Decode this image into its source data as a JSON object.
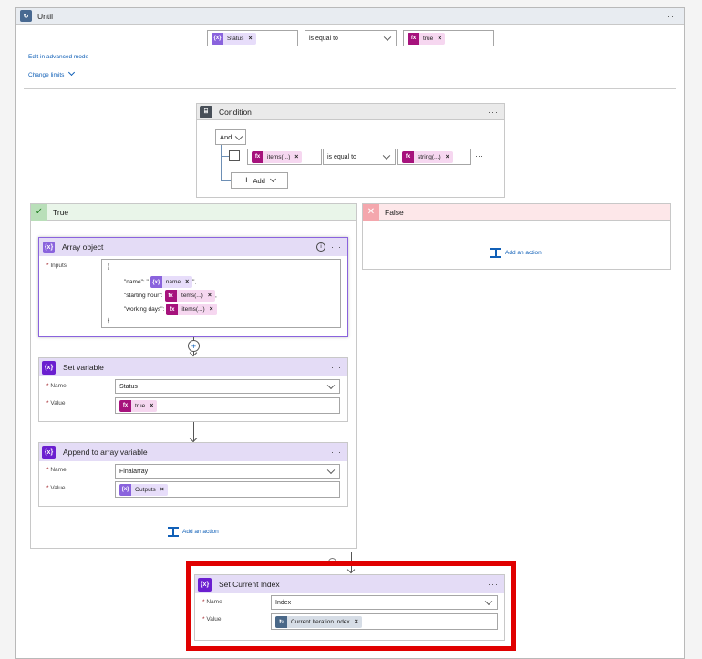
{
  "until": {
    "title": "Until",
    "condition": {
      "left_token": "Status",
      "operator": "is equal to",
      "right_token": "true"
    },
    "advanced_link": "Edit in advanced mode",
    "limits_link": "Change limits"
  },
  "condition_block": {
    "title": "Condition",
    "and_label": "And",
    "row": {
      "left_token": "items(...)",
      "operator": "is equal to",
      "right_token": "string(...)"
    },
    "add_label": "Add"
  },
  "true_branch": {
    "title": "True",
    "array_object": {
      "title": "Array object",
      "inputs_label": "Inputs",
      "open_brace": "{",
      "close_brace": "}",
      "lines": [
        {
          "key": "\"name\": \"",
          "token": "name",
          "suffix": "\","
        },
        {
          "key": "\"starting hour\":",
          "token": "items(...)",
          "suffix": ","
        },
        {
          "key": "\"working days\":",
          "token": "items(...)",
          "suffix": ""
        }
      ]
    },
    "set_variable": {
      "title": "Set variable",
      "name_label": "Name",
      "name_value": "Status",
      "value_label": "Value",
      "value_token": "true"
    },
    "append": {
      "title": "Append to array variable",
      "name_label": "Name",
      "name_value": "Finalarray",
      "value_label": "Value",
      "value_token": "Outputs"
    },
    "add_action": "Add an action"
  },
  "false_branch": {
    "title": "False",
    "add_action": "Add an action"
  },
  "set_current_index": {
    "title": "Set Current Index",
    "name_label": "Name",
    "name_value": "Index",
    "value_label": "Value",
    "value_token": "Current Iteration Index"
  },
  "colors": {
    "variable": "#6b1fd0",
    "expression": "#a6127c",
    "highlight": "#e00000",
    "true_header": "#e9f5e9",
    "false_header": "#fde7e9"
  }
}
